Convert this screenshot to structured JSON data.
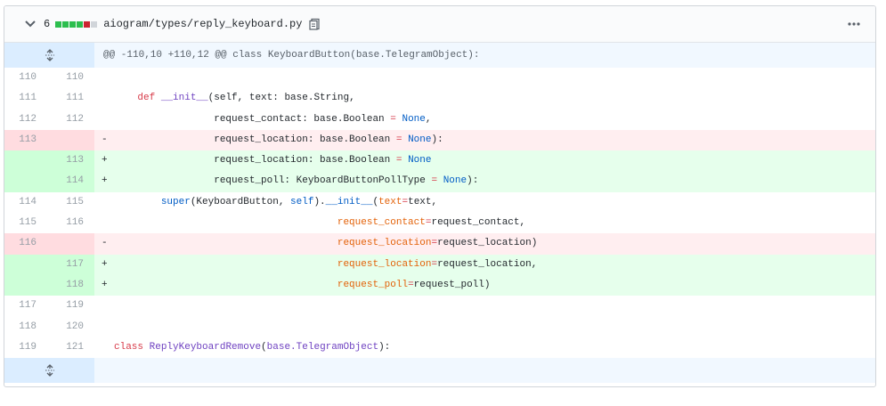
{
  "file": {
    "changes_count": "6",
    "path": "aiogram/types/reply_keyboard.py",
    "diffstat": [
      "#2cbe4e",
      "#2cbe4e",
      "#2cbe4e",
      "#2cbe4e",
      "#cb2431",
      "#d1d5da"
    ],
    "hunk_header": "@@ -110,10 +110,12 @@ class KeyboardButton(base.TelegramObject):"
  },
  "icons": {
    "collapse": "chevron-down-icon",
    "copy": "clipboard-icon",
    "menu": "kebab-horizontal-icon",
    "expand": "unfold-icon"
  },
  "lines": [
    {
      "type": "ctx",
      "old": "110",
      "new": "110",
      "sign": "",
      "tokens": []
    },
    {
      "type": "ctx",
      "old": "111",
      "new": "111",
      "sign": "",
      "tokens": [
        {
          "t": "    ",
          "c": ""
        },
        {
          "t": "def",
          "c": "kw"
        },
        {
          "t": " ",
          "c": ""
        },
        {
          "t": "__init__",
          "c": "fn"
        },
        {
          "t": "(self, text: base.String,",
          "c": ""
        }
      ]
    },
    {
      "type": "ctx",
      "old": "112",
      "new": "112",
      "sign": "",
      "tokens": [
        {
          "t": "                 request_contact: base.Boolean ",
          "c": ""
        },
        {
          "t": "=",
          "c": "kw"
        },
        {
          "t": " ",
          "c": ""
        },
        {
          "t": "None",
          "c": "nb"
        },
        {
          "t": ",",
          "c": ""
        }
      ]
    },
    {
      "type": "del",
      "old": "113",
      "new": "",
      "sign": "-",
      "tokens": [
        {
          "t": "                 request_location: base.Boolean ",
          "c": ""
        },
        {
          "t": "=",
          "c": "kw"
        },
        {
          "t": " ",
          "c": ""
        },
        {
          "t": "None",
          "c": "nb"
        },
        {
          "t": "):",
          "c": ""
        }
      ]
    },
    {
      "type": "add",
      "old": "",
      "new": "113",
      "sign": "+",
      "tokens": [
        {
          "t": "                 request_location: base.Boolean ",
          "c": ""
        },
        {
          "t": "=",
          "c": "kw"
        },
        {
          "t": " ",
          "c": ""
        },
        {
          "t": "None",
          "c": "nb"
        }
      ]
    },
    {
      "type": "add",
      "old": "",
      "new": "114",
      "sign": "+",
      "tokens": [
        {
          "t": "                 request_poll: KeyboardButtonPollType ",
          "c": ""
        },
        {
          "t": "=",
          "c": "kw"
        },
        {
          "t": " ",
          "c": ""
        },
        {
          "t": "None",
          "c": "nb"
        },
        {
          "t": "):",
          "c": ""
        }
      ]
    },
    {
      "type": "ctx",
      "old": "114",
      "new": "115",
      "sign": "",
      "tokens": [
        {
          "t": "        ",
          "c": ""
        },
        {
          "t": "super",
          "c": "nb"
        },
        {
          "t": "(KeyboardButton, ",
          "c": ""
        },
        {
          "t": "self",
          "c": "nb"
        },
        {
          "t": ").",
          "c": ""
        },
        {
          "t": "__init__",
          "c": "nb"
        },
        {
          "t": "(",
          "c": ""
        },
        {
          "t": "text",
          "c": "arg"
        },
        {
          "t": "=",
          "c": "kw"
        },
        {
          "t": "text,",
          "c": ""
        }
      ]
    },
    {
      "type": "ctx",
      "old": "115",
      "new": "116",
      "sign": "",
      "tokens": [
        {
          "t": "                                      ",
          "c": ""
        },
        {
          "t": "request_contact",
          "c": "arg"
        },
        {
          "t": "=",
          "c": "kw"
        },
        {
          "t": "request_contact,",
          "c": ""
        }
      ]
    },
    {
      "type": "del",
      "old": "116",
      "new": "",
      "sign": "-",
      "tokens": [
        {
          "t": "                                      ",
          "c": ""
        },
        {
          "t": "request_location",
          "c": "arg"
        },
        {
          "t": "=",
          "c": "kw"
        },
        {
          "t": "request_location)",
          "c": ""
        }
      ]
    },
    {
      "type": "add",
      "old": "",
      "new": "117",
      "sign": "+",
      "tokens": [
        {
          "t": "                                      ",
          "c": ""
        },
        {
          "t": "request_location",
          "c": "arg"
        },
        {
          "t": "=",
          "c": "kw"
        },
        {
          "t": "request_location,",
          "c": ""
        }
      ]
    },
    {
      "type": "add",
      "old": "",
      "new": "118",
      "sign": "+",
      "tokens": [
        {
          "t": "                                      ",
          "c": ""
        },
        {
          "t": "request_poll",
          "c": "arg"
        },
        {
          "t": "=",
          "c": "kw"
        },
        {
          "t": "request_poll)",
          "c": ""
        }
      ]
    },
    {
      "type": "ctx",
      "old": "117",
      "new": "119",
      "sign": "",
      "tokens": []
    },
    {
      "type": "ctx",
      "old": "118",
      "new": "120",
      "sign": "",
      "tokens": []
    },
    {
      "type": "ctx",
      "old": "119",
      "new": "121",
      "sign": "",
      "tokens": [
        {
          "t": "",
          "c": ""
        },
        {
          "t": "class",
          "c": "kw"
        },
        {
          "t": " ",
          "c": ""
        },
        {
          "t": "ReplyKeyboardRemove",
          "c": "fn"
        },
        {
          "t": "(",
          "c": ""
        },
        {
          "t": "base.TelegramObject",
          "c": "fn"
        },
        {
          "t": "):",
          "c": ""
        }
      ]
    }
  ]
}
